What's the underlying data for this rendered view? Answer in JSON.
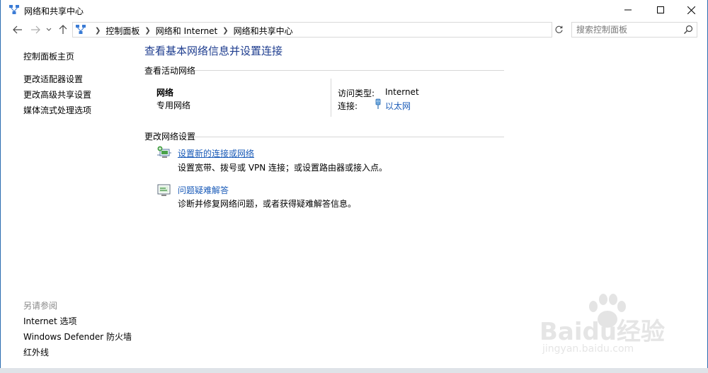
{
  "window": {
    "title": "网络和共享中心"
  },
  "address": {
    "crumbs": [
      "控制面板",
      "网络和 Internet",
      "网络和共享中心"
    ],
    "search_placeholder": "搜索控制面板"
  },
  "sidebar": {
    "home": "控制面板主页",
    "items": [
      "更改适配器设置",
      "更改高级共享设置",
      "媒体流式处理选项"
    ],
    "see_also_heading": "另请参阅",
    "see_also": [
      "Internet 选项",
      "Windows Defender 防火墙",
      "红外线"
    ]
  },
  "main": {
    "title": "查看基本网络信息并设置连接",
    "active_heading": "查看活动网络",
    "network_name": "网络",
    "network_type": "专用网络",
    "access_type_label": "访问类型:",
    "access_type_value": "Internet",
    "connection_label": "连接:",
    "connection_value": "以太网",
    "change_heading": "更改网络设置",
    "tasks": [
      {
        "link": "设置新的连接或网络",
        "desc": "设置宽带、拨号或 VPN 连接；或设置路由器或接入点。",
        "icon": "new-connection-icon"
      },
      {
        "link": "问题疑难解答",
        "desc": "诊断并修复网络问题，或者获得疑难解答信息。",
        "icon": "troubleshoot-icon"
      }
    ]
  },
  "watermark": {
    "brand": "Baidu经验",
    "url": "jingyan.baidu.com"
  },
  "colors": {
    "link": "#1a5bb8",
    "title": "#1e3d8f",
    "border": "#2b6cb0"
  }
}
